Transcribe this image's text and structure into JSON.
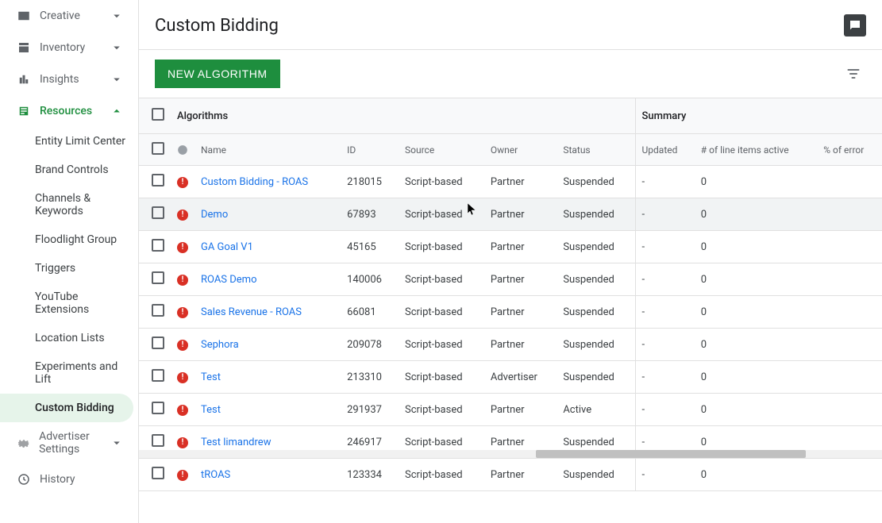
{
  "sidebar": {
    "top_items": [
      {
        "label": "Creative"
      },
      {
        "label": "Inventory"
      },
      {
        "label": "Insights"
      }
    ],
    "resources_label": "Resources",
    "sub_items": [
      {
        "label": "Entity Limit Center"
      },
      {
        "label": "Brand Controls"
      },
      {
        "label": "Channels & Keywords"
      },
      {
        "label": "Floodlight Group"
      },
      {
        "label": "Triggers"
      },
      {
        "label": "YouTube Extensions"
      },
      {
        "label": "Location Lists"
      },
      {
        "label": "Experiments and Lift"
      },
      {
        "label": "Custom Bidding"
      },
      {
        "label": "Advertiser Settings"
      },
      {
        "label": "History"
      }
    ]
  },
  "page": {
    "title": "Custom Bidding",
    "new_algorithm_label": "NEW ALGORITHM"
  },
  "table": {
    "group_algorithms": "Algorithms",
    "group_summary": "Summary",
    "columns": {
      "name": "Name",
      "id": "ID",
      "source": "Source",
      "owner": "Owner",
      "status": "Status",
      "updated": "Updated",
      "line_items": "# of line items active",
      "pct_error": "% of error"
    },
    "rows": [
      {
        "name": "Custom Bidding - ROAS",
        "id": "218015",
        "source": "Script-based",
        "owner": "Partner",
        "status": "Suspended",
        "updated": "-",
        "line_items": "0"
      },
      {
        "name": "Demo",
        "id": "67893",
        "source": "Script-based",
        "owner": "Partner",
        "status": "Suspended",
        "updated": "-",
        "line_items": "0"
      },
      {
        "name": "GA Goal V1",
        "id": "45165",
        "source": "Script-based",
        "owner": "Partner",
        "status": "Suspended",
        "updated": "-",
        "line_items": "0"
      },
      {
        "name": "ROAS Demo",
        "id": "140006",
        "source": "Script-based",
        "owner": "Partner",
        "status": "Suspended",
        "updated": "-",
        "line_items": "0"
      },
      {
        "name": "Sales Revenue - ROAS",
        "id": "66081",
        "source": "Script-based",
        "owner": "Partner",
        "status": "Suspended",
        "updated": "-",
        "line_items": "0"
      },
      {
        "name": "Sephora",
        "id": "209078",
        "source": "Script-based",
        "owner": "Partner",
        "status": "Suspended",
        "updated": "-",
        "line_items": "0"
      },
      {
        "name": "Test",
        "id": "213310",
        "source": "Script-based",
        "owner": "Advertiser",
        "status": "Suspended",
        "updated": "-",
        "line_items": "0"
      },
      {
        "name": "Test",
        "id": "291937",
        "source": "Script-based",
        "owner": "Partner",
        "status": "Active",
        "updated": "-",
        "line_items": "0"
      },
      {
        "name": "Test limandrew",
        "id": "246917",
        "source": "Script-based",
        "owner": "Partner",
        "status": "Suspended",
        "updated": "-",
        "line_items": "0"
      },
      {
        "name": "tROAS",
        "id": "123334",
        "source": "Script-based",
        "owner": "Partner",
        "status": "Suspended",
        "updated": "-",
        "line_items": "0"
      }
    ]
  }
}
